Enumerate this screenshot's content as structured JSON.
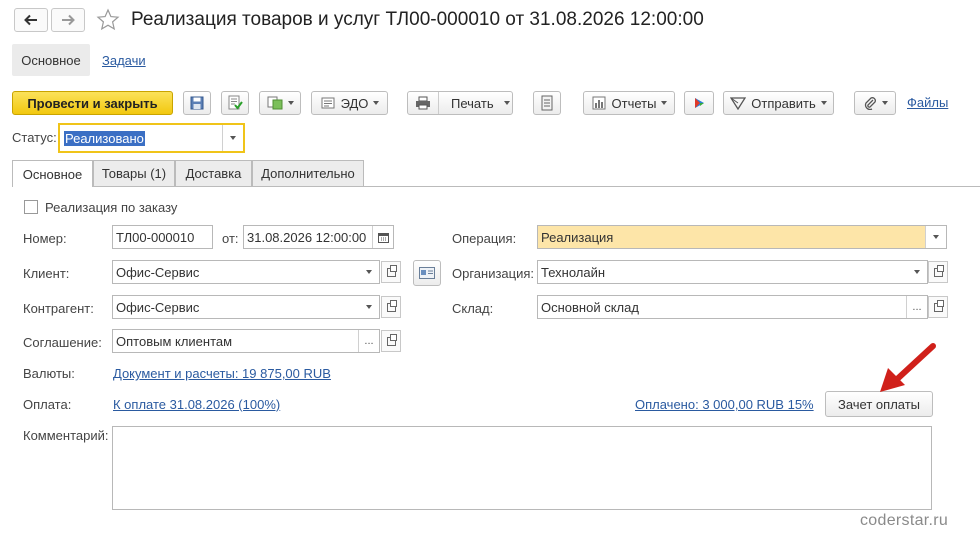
{
  "window": {
    "title": "Реализация товаров и услуг ТЛ00-000010 от 31.08.2026 12:00:00"
  },
  "nav": {
    "back_icon": "arrow-left-icon",
    "forward_icon": "arrow-right-icon",
    "favorite_icon": "star-icon"
  },
  "section_tabs": [
    {
      "label": "Основное"
    },
    {
      "label": "Задачи"
    }
  ],
  "toolbar": {
    "post_close": "Провести и закрыть",
    "edo": "ЭДО",
    "print": "Печать",
    "reports": "Отчеты",
    "send": "Отправить",
    "files": "Файлы",
    "icons": [
      "save-icon",
      "post-icon",
      "create-based-icon",
      "edo-icon",
      "print-icon",
      "journal-icon",
      "reports-icon",
      "structure-icon",
      "send-icon",
      "attach-icon"
    ]
  },
  "status": {
    "label": "Статус:",
    "value": "Реализовано"
  },
  "tabs": [
    {
      "label": "Основное"
    },
    {
      "label": "Товары (1)"
    },
    {
      "label": "Доставка"
    },
    {
      "label": "Дополнительно"
    }
  ],
  "form": {
    "by_order": {
      "label": "Реализация по заказу",
      "checked": false
    },
    "number": {
      "label": "Номер:",
      "value": "ТЛ00-000010"
    },
    "date": {
      "label": "от:",
      "value": "31.08.2026 12:00:00"
    },
    "client": {
      "label": "Клиент:",
      "value": "Офис-Сервис"
    },
    "counterparty": {
      "label": "Контрагент:",
      "value": "Офис-Сервис"
    },
    "agreement": {
      "label": "Соглашение:",
      "value": "Оптовым клиентам"
    },
    "operation": {
      "label": "Операция:",
      "value": "Реализация"
    },
    "organization": {
      "label": "Организация:",
      "value": "Технолайн"
    },
    "warehouse": {
      "label": "Склад:",
      "value": "Основной склад"
    },
    "currency": {
      "label": "Валюты:",
      "link": "Документ и расчеты: 19 875,00 RUB"
    },
    "payment": {
      "label": "Оплата:",
      "link": "К оплате 31.08.2026 (100%)",
      "paid_link": "Оплачено: 3 000,00 RUB 15%",
      "offset_button": "Зачет оплаты"
    },
    "comment": {
      "label": "Комментарий:",
      "value": ""
    }
  },
  "watermark": "coderstar.ru",
  "colors": {
    "primary_button": "#f2c80f",
    "operation_highlight": "#fde5a8",
    "link": "#2a5aa0",
    "annotation_arrow": "#d0201a"
  }
}
